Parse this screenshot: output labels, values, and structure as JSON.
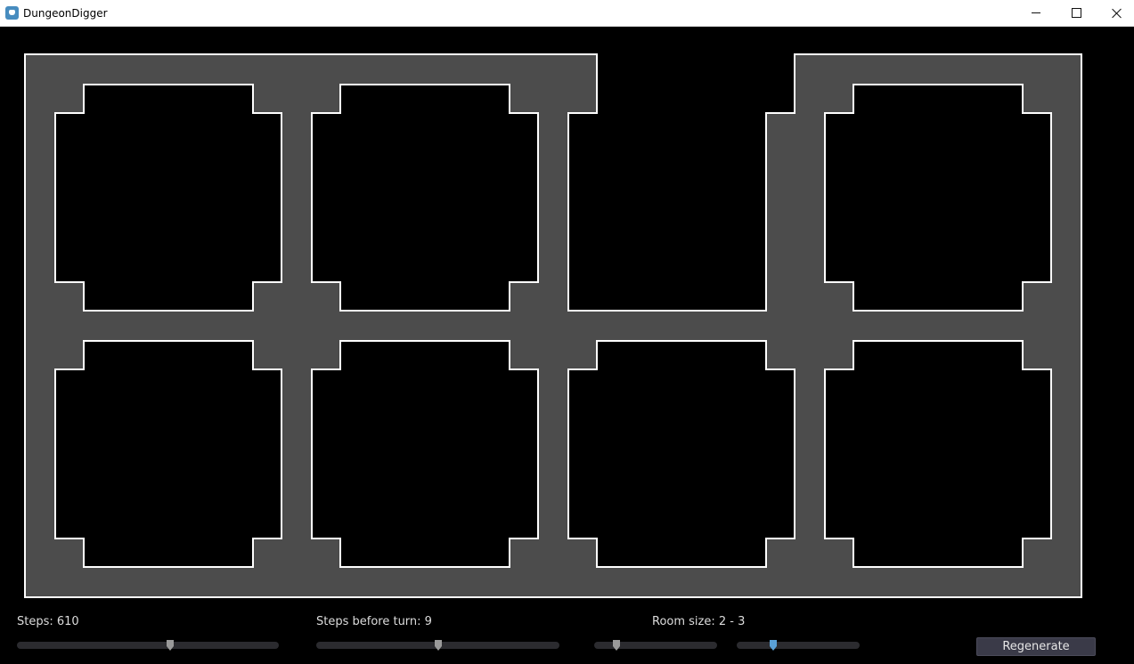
{
  "window": {
    "title": "DungeonDigger",
    "icon": "godot-app-icon",
    "buttons": [
      "minimize",
      "maximize",
      "close"
    ]
  },
  "colors": {
    "background": "#000000",
    "floor": "#4c4c4c",
    "wall_outline": "#ffffff",
    "label_text": "#dcdcdc",
    "slider_track": "#2b2b2f",
    "slider_grabber": "#9a9a9a",
    "slider_grabber_active": "#5aa0d6",
    "button_bg": "#3a3a48"
  },
  "map": {
    "layout": "2 rows × 4 rooms, open floor area with a notch in the top edge above the third room"
  },
  "controls": {
    "steps_label": "Steps: 610",
    "steps_before_turn_label": "Steps before turn: 9",
    "room_size_label": "Room size: 2 - 3",
    "regenerate_label": "Regenerate",
    "sliders": {
      "steps": {
        "fraction": 0.585,
        "active": false
      },
      "steps_before_turn": {
        "fraction": 0.5,
        "active": false
      },
      "room_size_min": {
        "fraction": 0.18,
        "active": false
      },
      "room_size_max": {
        "fraction": 0.3,
        "active": true
      }
    }
  }
}
